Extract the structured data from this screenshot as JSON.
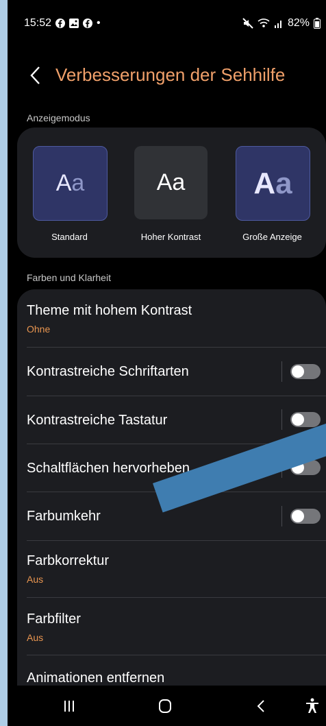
{
  "status_bar": {
    "time": "15:52",
    "dot": "•",
    "battery": "82%",
    "left_icons": [
      "facebook-icon",
      "gallery-icon",
      "facebook-icon"
    ],
    "right_icons": [
      "mute-icon",
      "wifi-icon",
      "signal-icon",
      "battery-icon"
    ]
  },
  "header": {
    "title": "Verbesserungen der Sehhilfe"
  },
  "sections": {
    "display_mode": "Anzeigemodus",
    "colors": "Farben und Klarheit"
  },
  "modes": [
    {
      "preview_a": "A",
      "preview_b": "a",
      "label": "Standard"
    },
    {
      "preview": "Aa",
      "label": "Hoher Kontrast"
    },
    {
      "preview_a": "A",
      "preview_b": "a",
      "label": "Große Anzeige"
    }
  ],
  "settings": [
    {
      "title": "Theme mit hohem Kontrast",
      "subtitle": "Ohne"
    },
    {
      "title": "Kontrastreiche Schriftarten",
      "toggle": "off"
    },
    {
      "title": "Kontrastreiche Tastatur",
      "toggle": "off"
    },
    {
      "title": "Schaltflächen hervorheben",
      "toggle": "off"
    },
    {
      "title": "Farbumkehr",
      "toggle": "off"
    },
    {
      "title": "Farbkorrektur",
      "subtitle": "Aus"
    },
    {
      "title": "Farbfilter",
      "subtitle": "Aus"
    },
    {
      "title": "Animationen entfernen"
    }
  ],
  "colors": {
    "accent_title": "#f0a06a",
    "accent_sub": "#e89550",
    "overlay": "#3f7db0",
    "page_border": "#aecde6"
  },
  "navbar": {
    "buttons": [
      "recents-icon",
      "home-icon",
      "back-icon",
      "accessibility-icon"
    ]
  }
}
